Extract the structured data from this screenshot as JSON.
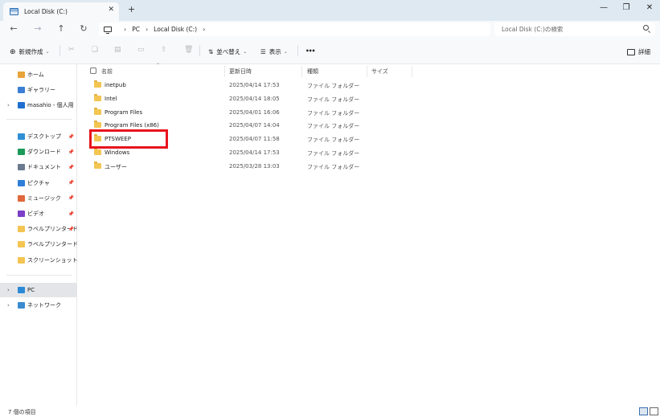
{
  "window": {
    "tab_title": "Local Disk (C:)",
    "tab_close_glyph": "✕",
    "new_tab_glyph": "+",
    "minimize_glyph": "—",
    "maximize_glyph": "❐",
    "close_glyph": "✕"
  },
  "nav": {
    "back_glyph": "←",
    "forward_glyph": "→",
    "up_glyph": "↑",
    "refresh_glyph": "↻",
    "breadcrumb": [
      "PC",
      "Local Disk (C:)"
    ],
    "breadcrumb_sep": "›",
    "search_placeholder": "Local Disk (C:)の検索"
  },
  "toolbar": {
    "new_glyph": "⊕",
    "new_label": "新規作成",
    "sort_glyph": "⇅",
    "sort_label": "並べ替え",
    "view_glyph": "☰",
    "view_label": "表示",
    "more_glyph": "•••",
    "caret_glyph": "⌄",
    "details_label": "詳細",
    "icons": [
      "cut-icon",
      "copy-icon",
      "paste-icon",
      "rename-icon",
      "share-icon",
      "delete-icon",
      "details-pane-icon"
    ]
  },
  "sidebar": {
    "pin_glyph": "📌",
    "expand_glyph": "›",
    "top": [
      {
        "label": "ホーム",
        "icon": "home-icon",
        "color": "#e8a33a"
      },
      {
        "label": "ギャラリー",
        "icon": "gallery-icon",
        "color": "#3b7fd4"
      },
      {
        "label": "masahio - 個人用",
        "icon": "cloud-icon",
        "color": "#1f6fd0"
      }
    ],
    "pinned": [
      {
        "label": "デスクトップ",
        "icon": "desktop-icon",
        "color": "#2e8fd6"
      },
      {
        "label": "ダウンロード",
        "icon": "download-icon",
        "color": "#1b9a5a"
      },
      {
        "label": "ドキュメント",
        "icon": "documents-icon",
        "color": "#6b7a8f"
      },
      {
        "label": "ピクチャ",
        "icon": "pictures-icon",
        "color": "#2f7fd8"
      },
      {
        "label": "ミュージック",
        "icon": "music-icon",
        "color": "#e0673a"
      },
      {
        "label": "ビデオ",
        "icon": "videos-icon",
        "color": "#7b3fc8"
      },
      {
        "label": "ラベルプリンタードラ",
        "icon": "folder-icon",
        "color": "#f3c552"
      },
      {
        "label": "ラベルプリンタードライバ",
        "icon": "folder-icon",
        "color": "#f3c552"
      },
      {
        "label": "スクリーンショット",
        "icon": "folder-icon",
        "color": "#f3c552"
      }
    ],
    "devices": [
      {
        "label": "PC",
        "icon": "pc-icon",
        "color": "#2a8ad8"
      },
      {
        "label": "ネットワーク",
        "icon": "network-icon",
        "color": "#3a8bd0"
      }
    ]
  },
  "columns": [
    "名前",
    "更新日時",
    "種類",
    "サイズ"
  ],
  "sort_caret_glyph": "⌃",
  "files": [
    {
      "name": "inetpub",
      "date": "2025/04/14 17:53",
      "type": "ファイル フォルダー"
    },
    {
      "name": "Intel",
      "date": "2025/04/14 18:05",
      "type": "ファイル フォルダー"
    },
    {
      "name": "Program Files",
      "date": "2025/04/01 16:06",
      "type": "ファイル フォルダー"
    },
    {
      "name": "Program Files (x86)",
      "date": "2025/04/07 14:04",
      "type": "ファイル フォルダー"
    },
    {
      "name": "PTSWEEP",
      "date": "2025/04/07 11:58",
      "type": "ファイル フォルダー"
    },
    {
      "name": "Windows",
      "date": "2025/04/14 17:53",
      "type": "ファイル フォルダー"
    },
    {
      "name": "ユーザー",
      "date": "2025/03/28 13:03",
      "type": "ファイル フォルダー"
    }
  ],
  "status": {
    "item_count": "7 個の項目"
  }
}
